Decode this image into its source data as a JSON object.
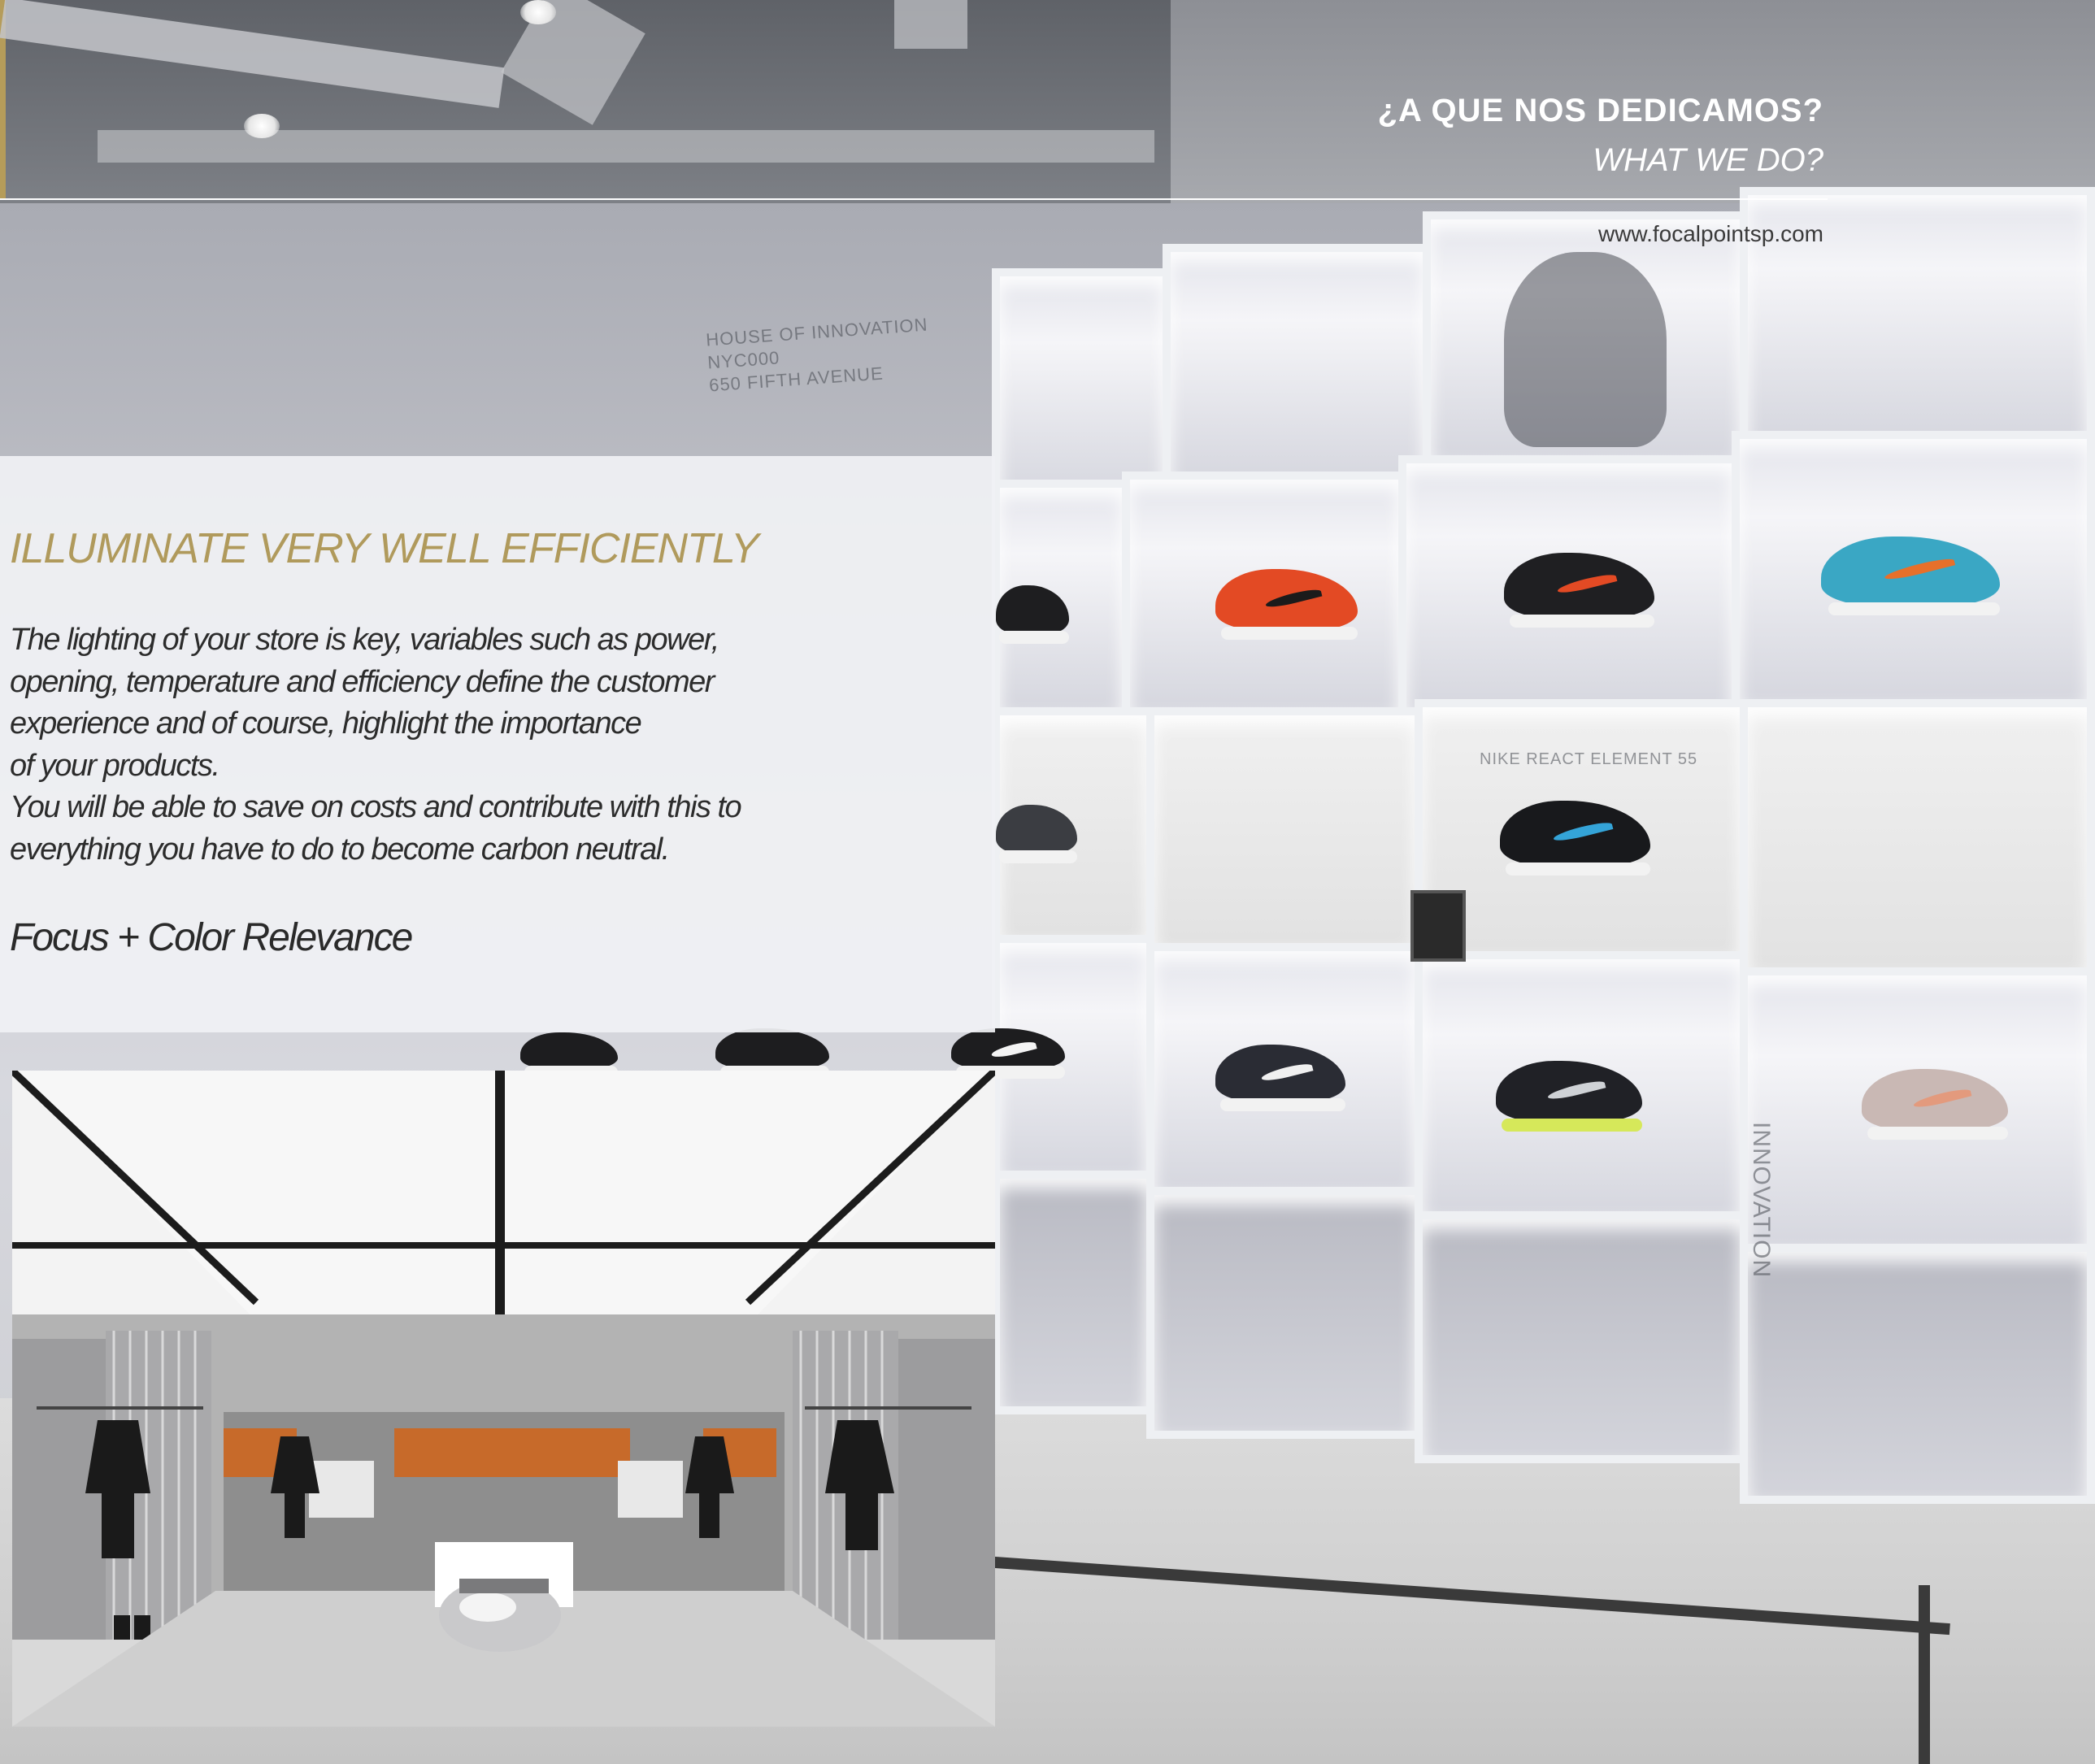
{
  "header": {
    "title": "¿A QUE NOS DEDICAMOS?",
    "subtitle": "WHAT WE DO?",
    "url": "www.focalpointsp.com"
  },
  "section": {
    "heading": "ILLUMINATE VERY WELL EFFICIENTLY",
    "body_lines": [
      "The lighting of your store is key, variables such as power,",
      "opening, temperature and efficiency define the customer",
      "experience and of course, highlight the importance",
      "of your products.",
      "You will be able to save on costs and contribute with this to",
      "everything you have to do to become carbon neutral."
    ],
    "tagline": "Focus + Color Relevance"
  },
  "wall_signage": {
    "sign_lines": [
      "HOUSE OF INNOVATION",
      "NYC000",
      "650 FIFTH AVENUE"
    ],
    "vertical_sign": "INNOVATION",
    "element_sign": "NIKE REACT ELEMENT 55"
  },
  "colors": {
    "accent_gold": "#b09a5c",
    "header_text": "#ffffff",
    "body_text": "#2c2c2c"
  }
}
